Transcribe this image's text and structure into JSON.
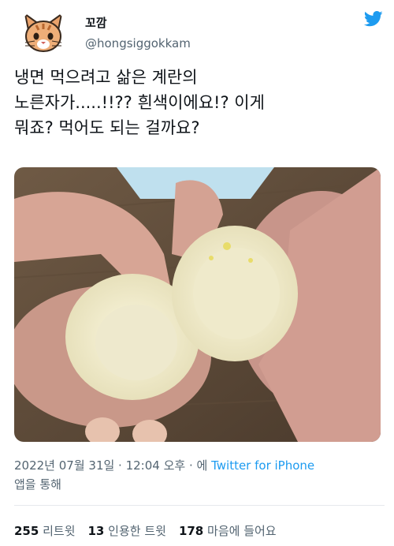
{
  "user": {
    "display_name": "꼬깜",
    "handle": "@hongsiggokkam",
    "avatar_icon": "cat-face-avatar-icon"
  },
  "tweet": {
    "lines": [
      "냉면 먹으려고 삶은 계란의",
      "노른자가.....!!?? 흰색이에요!? 이게",
      "뭐죠? 먹어도 되는 걸까요?"
    ]
  },
  "media": {
    "description_icon": "boiled-egg-photo"
  },
  "meta": {
    "timestamp": "2022년 07월 31일 · 12:04 오후 · 에",
    "source": "Twitter for iPhone",
    "via": "앱을 통해"
  },
  "stats": {
    "retweets": "255",
    "retweets_label": "리트윗",
    "quotes": "13",
    "quotes_label": "인용한 트윗",
    "likes": "178",
    "likes_label": "마음에 들어요"
  },
  "colors": {
    "accent": "#1d9bf0",
    "muted": "#536471",
    "text": "#0f1419"
  }
}
